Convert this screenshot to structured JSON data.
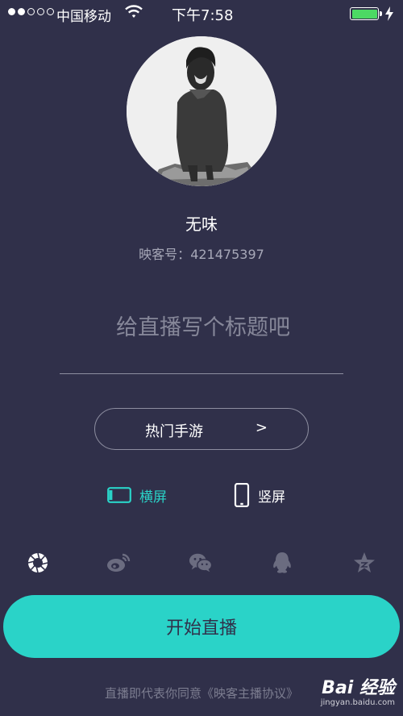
{
  "status_bar": {
    "carrier": "中国移动",
    "time": "下午7:58",
    "signal_bars_filled": 2,
    "signal_bars_total": 5,
    "battery_level": 1.0,
    "battery_color": "#4cd964",
    "charging": true
  },
  "profile": {
    "name": "无味",
    "id_label": "映客号：",
    "id_value": "421475397"
  },
  "title_field": {
    "placeholder": "给直播写个标题吧",
    "value": ""
  },
  "category": {
    "label": "热门手游",
    "arrow": ">"
  },
  "orientation": {
    "landscape_label": "横屏",
    "portrait_label": "竖屏",
    "selected": "landscape"
  },
  "share_icons": [
    "camera-aperture-icon",
    "weibo-icon",
    "wechat-icon",
    "qq-icon",
    "qzone-icon"
  ],
  "start_button": {
    "label": "开始直播"
  },
  "agreement": {
    "prefix": "直播即代表你同意",
    "link": "《映客主播协议》"
  },
  "watermark": {
    "main": "Bai 经验",
    "sub": "jingyan.baidu.com"
  },
  "colors": {
    "background": "#30304a",
    "accent": "#2ad3c8",
    "muted_text": "#a7a8b8"
  }
}
